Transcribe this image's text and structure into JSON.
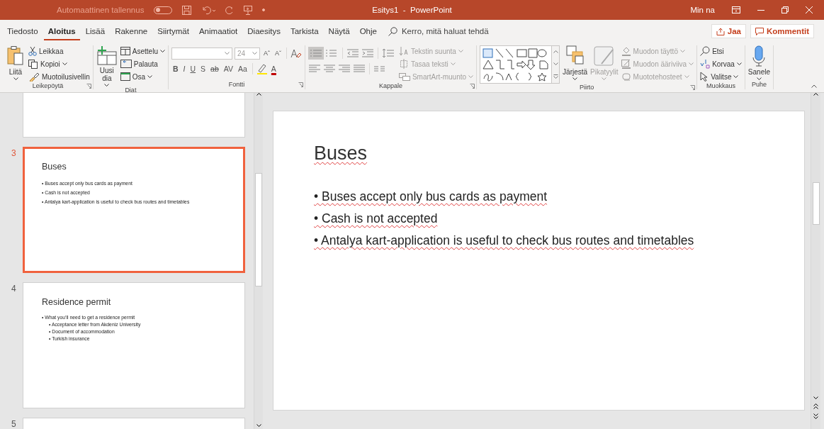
{
  "title_bar": {
    "autosave_label": "Automaattinen tallennus",
    "autosave_on": false,
    "title": "Esitys1  -  PowerPoint",
    "user": "Min na"
  },
  "tabs": [
    {
      "label": "Tiedosto",
      "selected": false
    },
    {
      "label": "Aloitus",
      "selected": true
    },
    {
      "label": "Lisää",
      "selected": false
    },
    {
      "label": "Rakenne",
      "selected": false
    },
    {
      "label": "Siirtymät",
      "selected": false
    },
    {
      "label": "Animaatiot",
      "selected": false
    },
    {
      "label": "Diaesitys",
      "selected": false
    },
    {
      "label": "Tarkista",
      "selected": false
    },
    {
      "label": "Näytä",
      "selected": false
    },
    {
      "label": "Ohje",
      "selected": false
    }
  ],
  "search": {
    "placeholder": "Kerro, mitä haluat tehdä"
  },
  "share_buttons": [
    "Jaa",
    "Kommentit"
  ],
  "ribbon": [
    {
      "label": "Leikepöytä",
      "launcher": true,
      "columns": [
        {
          "kind": "large",
          "label": "Liitä",
          "caret": true,
          "disabled": false
        },
        {
          "kind": "stack",
          "items": [
            {
              "label": "Leikkaa",
              "caret": false,
              "disabled": false
            },
            {
              "label": "Kopioi",
              "caret": true,
              "disabled": false
            },
            {
              "label": "Muotoilusivellin",
              "caret": false,
              "disabled": false
            }
          ]
        }
      ]
    },
    {
      "label": "Diat",
      "launcher": false,
      "columns": [
        {
          "kind": "large",
          "label": "Uusi dia",
          "caret": true,
          "disabled": false
        },
        {
          "kind": "stack",
          "items": [
            {
              "label": "Asettelu",
              "caret": true,
              "disabled": false
            },
            {
              "label": "Palauta",
              "caret": false,
              "disabled": false
            },
            {
              "label": "Osa",
              "caret": true,
              "disabled": false
            }
          ]
        }
      ]
    },
    {
      "label": "Fontti",
      "launcher": true,
      "columns": [
        {
          "kind": "font",
          "size": "24",
          "grow": [
            "Aˆ",
            "Aˇ"
          ],
          "styles": [
            "B",
            "I",
            "U",
            "S",
            "ab",
            "AV",
            "Aa"
          ],
          "color_glyph": "A"
        }
      ]
    },
    {
      "label": "Kappale",
      "launcher": true,
      "columns": [
        {
          "kind": "paragraph",
          "bullets_on": true,
          "items": [
            {
              "label": "Tekstin suunta",
              "caret": true,
              "disabled": true
            },
            {
              "label": "Tasaa teksti",
              "caret": true,
              "disabled": true
            },
            {
              "label": "SmartArt-muunto",
              "caret": true,
              "disabled": true
            }
          ]
        }
      ]
    },
    {
      "label": "Piirto",
      "launcher": true,
      "columns": [
        {
          "kind": "gallery"
        },
        {
          "kind": "large",
          "label": "Järjestä",
          "caret": true,
          "disabled": false
        },
        {
          "kind": "large",
          "label": "Pikatyylit",
          "caret": true,
          "disabled": true
        },
        {
          "kind": "stack",
          "items": [
            {
              "label": "Muodon täyttö",
              "caret": true,
              "disabled": true
            },
            {
              "label": "Muodon ääriviiva",
              "caret": true,
              "disabled": true
            },
            {
              "label": "Muototehosteet",
              "caret": true,
              "disabled": true
            }
          ]
        }
      ]
    },
    {
      "label": "Muokkaus",
      "launcher": false,
      "columns": [
        {
          "kind": "stack",
          "items": [
            {
              "label": "Etsi",
              "caret": false,
              "disabled": false
            },
            {
              "label": "Korvaa",
              "caret": true,
              "disabled": false
            },
            {
              "label": "Valitse",
              "caret": true,
              "disabled": false
            }
          ]
        }
      ]
    },
    {
      "label": "Puhe",
      "launcher": false,
      "columns": [
        {
          "kind": "large",
          "label": "Sanele",
          "caret": true,
          "disabled": false
        }
      ]
    }
  ],
  "thumbnails": [
    {
      "selected": false
    },
    {
      "number": "3",
      "selected": true,
      "title": "Buses",
      "bullets": [
        {
          "text": "• Buses accept only bus cards as payment"
        },
        {
          "text": "• Cash is not accepted"
        },
        {
          "text": "• Antalya kart-application is useful to check bus routes and timetables"
        }
      ]
    },
    {
      "number": "4",
      "selected": false,
      "title": "Residence permit",
      "bullets": [
        {
          "text": "• What you’ll need to get a residence permit",
          "children": [
            {
              "text": "• Acceptance letter from Akdeniz University"
            },
            {
              "text": "• Document of accommodation"
            },
            {
              "text": "• Turkish insurance"
            }
          ]
        }
      ]
    },
    {
      "number": "5",
      "selected": false
    }
  ],
  "slide": {
    "title": "Buses",
    "spelling_marks": true,
    "bullets": [
      {
        "text": "• Buses accept only bus cards as payment"
      },
      {
        "text": "• Cash is not accepted"
      },
      {
        "text": "• Antalya kart-application is useful to check bus routes and timetables"
      }
    ]
  }
}
